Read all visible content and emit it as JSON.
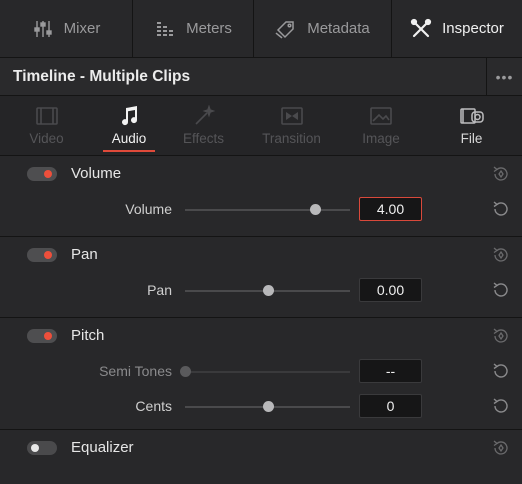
{
  "toolbar": {
    "mixer": "Mixer",
    "meters": "Meters",
    "metadata": "Metadata",
    "inspector": "Inspector"
  },
  "header": {
    "title": "Timeline - Multiple Clips",
    "more": "•••"
  },
  "tabs": [
    {
      "label": "Video",
      "state": "disabled",
      "icon": "film-icon"
    },
    {
      "label": "Audio",
      "state": "active",
      "icon": "music-note-icon"
    },
    {
      "label": "Effects",
      "state": "disabled",
      "icon": "magic-wand-icon"
    },
    {
      "label": "Transition",
      "state": "disabled",
      "icon": "transition-icon"
    },
    {
      "label": "Image",
      "state": "disabled",
      "icon": "image-icon"
    },
    {
      "label": "File",
      "state": "enabled",
      "icon": "file-icon"
    }
  ],
  "sections": {
    "volume": {
      "title": "Volume",
      "enabled": true,
      "params": [
        {
          "label": "Volume",
          "value": "4.00",
          "slider_fraction": 0.79
        }
      ]
    },
    "pan": {
      "title": "Pan",
      "enabled": true,
      "params": [
        {
          "label": "Pan",
          "value": "0.00",
          "slider_fraction": 0.5
        }
      ]
    },
    "pitch": {
      "title": "Pitch",
      "enabled": true,
      "params": [
        {
          "label": "Semi Tones",
          "value": "--",
          "slider_fraction": 0.0
        },
        {
          "label": "Cents",
          "value": "0",
          "slider_fraction": 0.5
        }
      ]
    },
    "equalizer": {
      "title": "Equalizer",
      "enabled": false
    }
  },
  "colors": {
    "accent": "#e04a3a",
    "toggle_on": "#ee4f3b"
  }
}
